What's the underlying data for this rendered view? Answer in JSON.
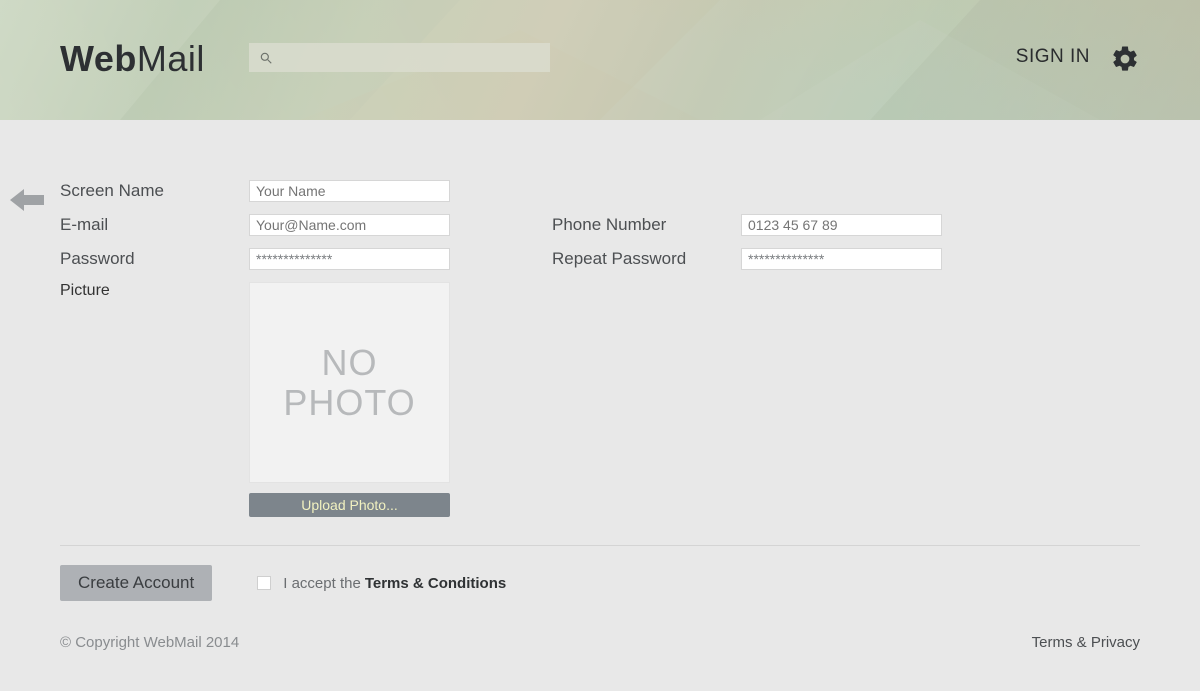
{
  "header": {
    "logo_bold": "Web",
    "logo_light": "Mail",
    "search_placeholder": "",
    "signin": "SIGN IN"
  },
  "form": {
    "screen_name_label": "Screen Name",
    "screen_name_placeholder": "Your Name",
    "email_label": "E-mail",
    "email_placeholder": "Your@Name.com",
    "phone_label": "Phone Number",
    "phone_placeholder": "0123 45 67 89",
    "password_label": "Password",
    "password_value": "**************",
    "repeat_password_label": "Repeat Password",
    "repeat_password_value": "**************",
    "picture_label": "Picture",
    "no_photo_line1": "NO",
    "no_photo_line2": "PHOTO",
    "upload_label": "Upload Photo..."
  },
  "bottom": {
    "create_label": "Create Account",
    "accept_prefix": "I accept the",
    "terms_label": "Terms & Conditions"
  },
  "footer": {
    "copyright": "© Copyright WebMail 2014",
    "terms_privacy": "Terms & Privacy"
  }
}
